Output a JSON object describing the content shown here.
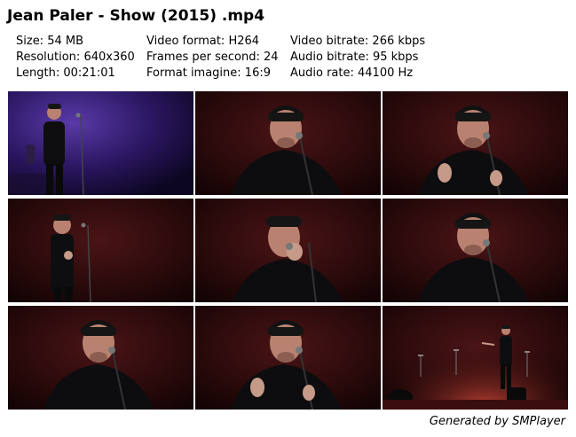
{
  "title": "Jean Paler - Show (2015) .mp4",
  "info": {
    "size": "Size: 54 MB",
    "resolution": "Resolution: 640x360",
    "length": "Length: 00:21:01",
    "video_format": "Video format: H264",
    "fps": "Frames per second: 24",
    "format_imagine": "Format imagine: 16:9",
    "video_bitrate": "Video bitrate: 266 kbps",
    "audio_bitrate": "Audio bitrate: 95 kbps",
    "audio_rate": "Audio rate: 44100 Hz"
  },
  "thumbnails": [
    {
      "shot": "wide",
      "bg": "purple"
    },
    {
      "shot": "close",
      "bg": "red"
    },
    {
      "shot": "close-gesture",
      "bg": "red"
    },
    {
      "shot": "medium",
      "bg": "red"
    },
    {
      "shot": "close-hand",
      "bg": "red"
    },
    {
      "shot": "close",
      "bg": "red"
    },
    {
      "shot": "close",
      "bg": "red"
    },
    {
      "shot": "close-gesture",
      "bg": "red"
    },
    {
      "shot": "stage-wide",
      "bg": "red"
    }
  ],
  "footer": "Generated by SMPlayer"
}
